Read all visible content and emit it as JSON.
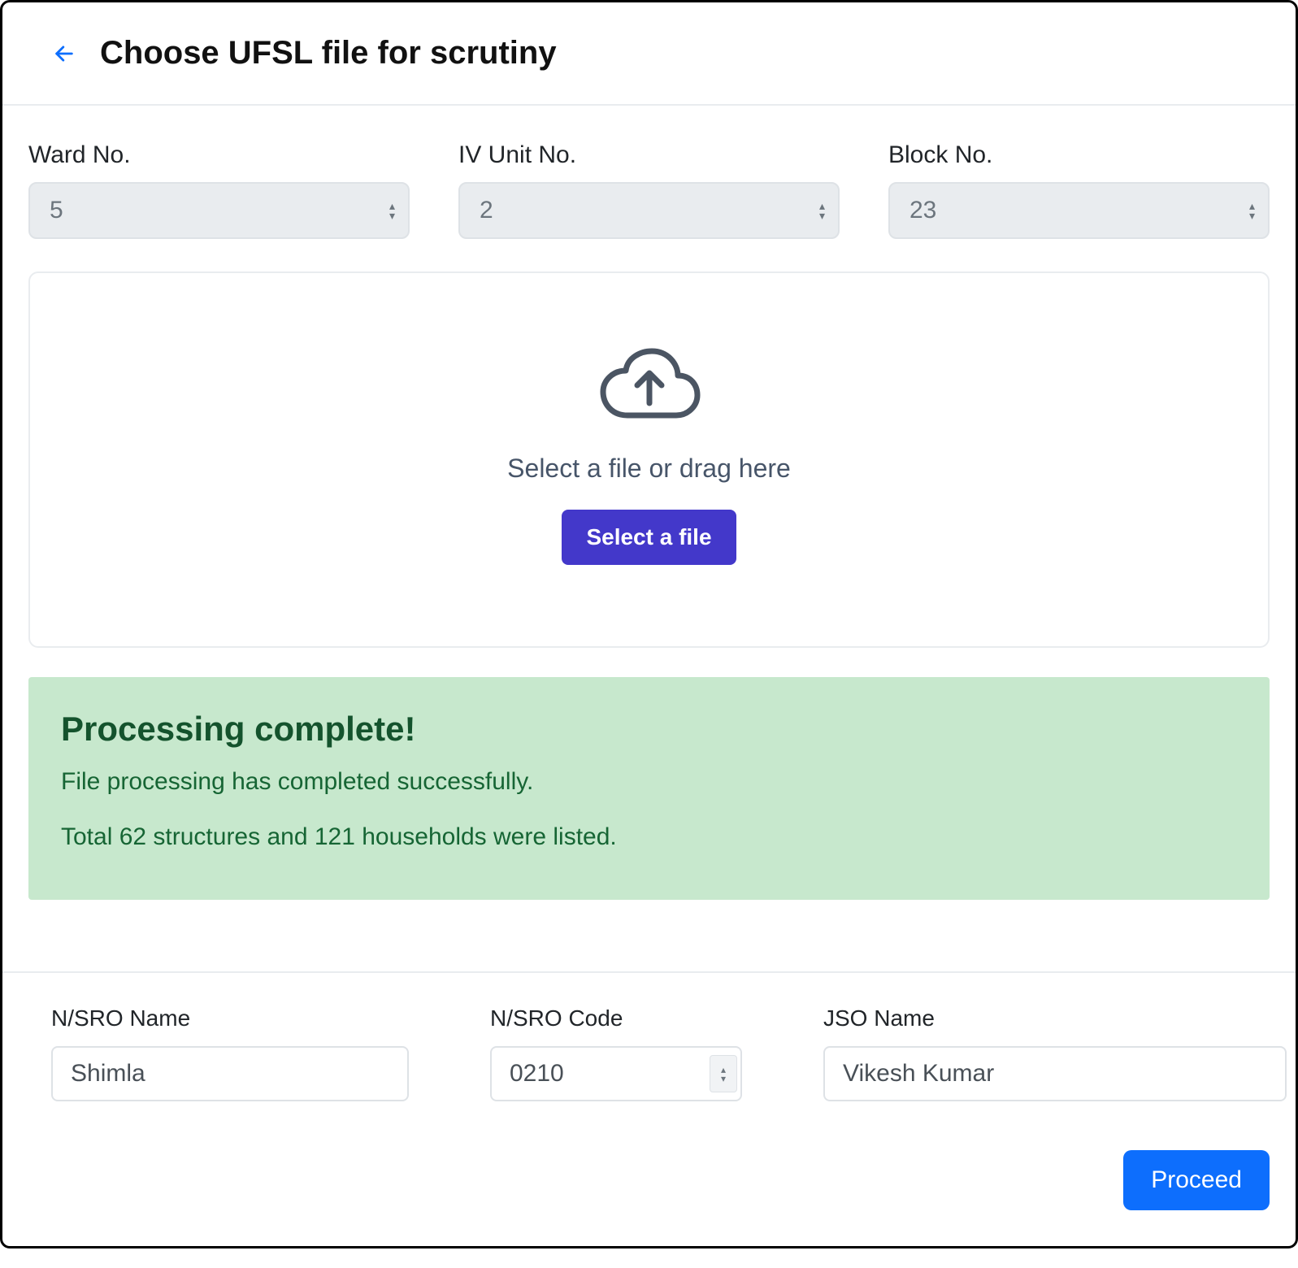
{
  "header": {
    "title": "Choose UFSL file for scrutiny"
  },
  "top_fields": {
    "ward": {
      "label": "Ward No.",
      "value": "5"
    },
    "iv": {
      "label": "IV Unit No.",
      "value": "2"
    },
    "block": {
      "label": "Block No.",
      "value": "23"
    }
  },
  "dropzone": {
    "text": "Select a file or drag here",
    "button": "Select a file"
  },
  "status": {
    "title": "Processing complete!",
    "line1": "File processing has completed successfully.",
    "line2": "Total 62 structures and 121 households were listed."
  },
  "bottom_fields": {
    "sro_name": {
      "label": "N/SRO Name",
      "value": "Shimla"
    },
    "sro_code": {
      "label": "N/SRO Code",
      "value": "0210"
    },
    "jso_name": {
      "label": "JSO Name",
      "value": "Vikesh Kumar"
    }
  },
  "actions": {
    "proceed": "Proceed"
  }
}
